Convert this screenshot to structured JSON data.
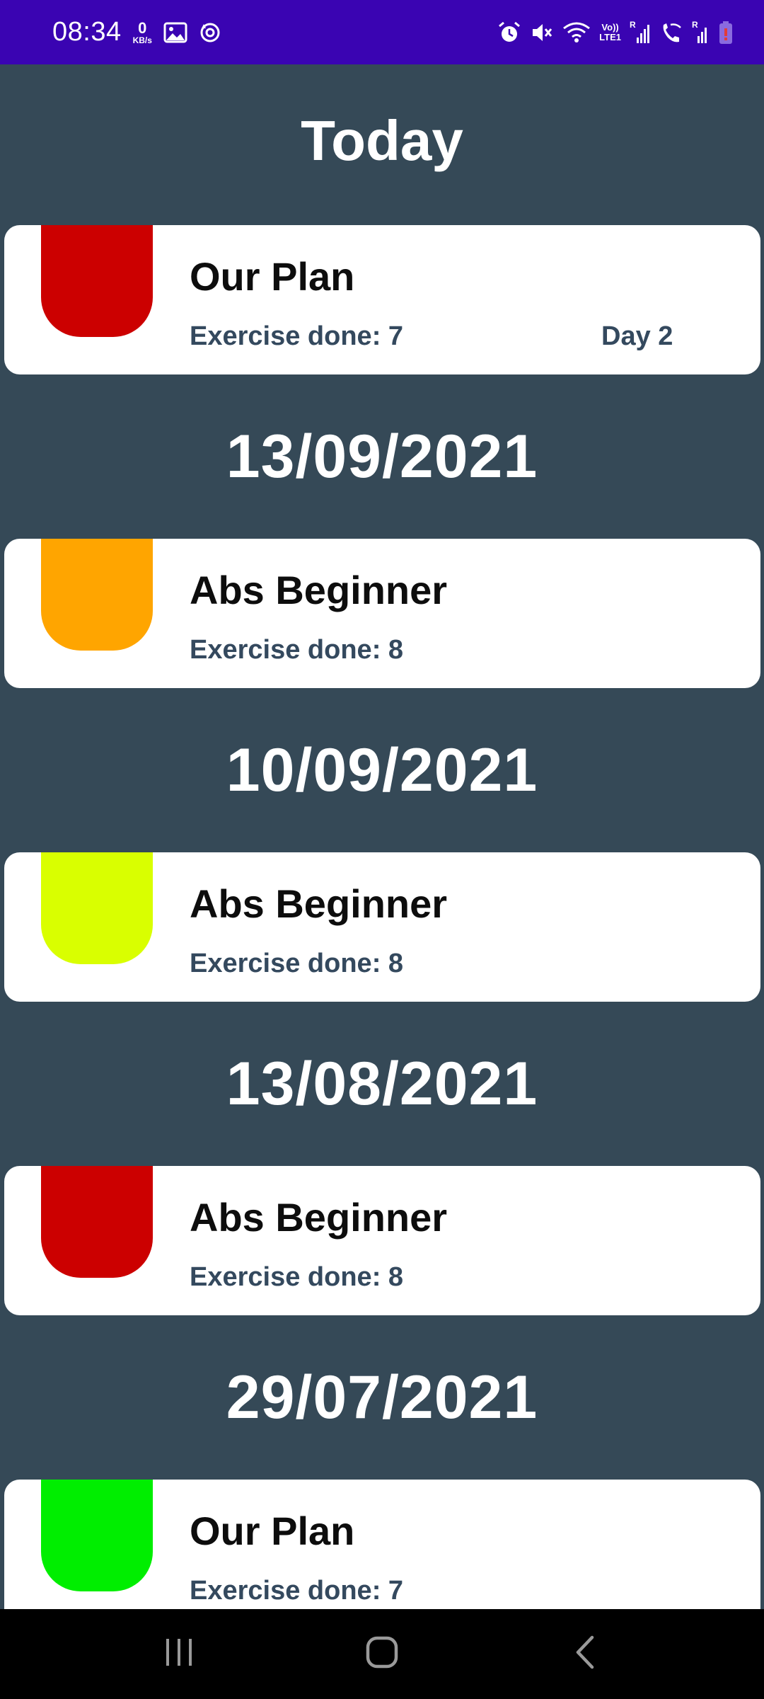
{
  "status_bar": {
    "time": "08:34",
    "net_speed_value": "0",
    "net_speed_unit": "KB/s",
    "network_label_top": "Vo))",
    "network_label_bottom": "LTE1",
    "sim1_label": "R",
    "sim2_label": "R",
    "icons": [
      "gallery-icon",
      "sync-icon",
      "alarm-icon",
      "mute-icon",
      "wifi-icon",
      "signal-icon",
      "wifi-calling-icon",
      "battery-icon"
    ]
  },
  "today": {
    "heading": "Today",
    "cards": [
      {
        "title": "Our Plan",
        "subtitle": "Exercise done: 7",
        "day": "Day 2",
        "color": "#cc0000"
      }
    ]
  },
  "history": [
    {
      "date": "13/09/2021",
      "card": {
        "title": "Abs Beginner",
        "subtitle": "Exercise done: 8",
        "color": "#ffa500"
      }
    },
    {
      "date": "10/09/2021",
      "card": {
        "title": "Abs Beginner",
        "subtitle": "Exercise done: 8",
        "color": "#d9ff00"
      }
    },
    {
      "date": "13/08/2021",
      "card": {
        "title": "Abs Beginner",
        "subtitle": "Exercise done: 8",
        "color": "#cc0000"
      }
    },
    {
      "date": "29/07/2021",
      "card": {
        "title": "Our Plan",
        "subtitle": "Exercise done: 7",
        "color": "#00ee00"
      }
    }
  ],
  "nav_bar": {
    "buttons": [
      "recent-apps-icon",
      "home-icon",
      "back-icon"
    ]
  }
}
